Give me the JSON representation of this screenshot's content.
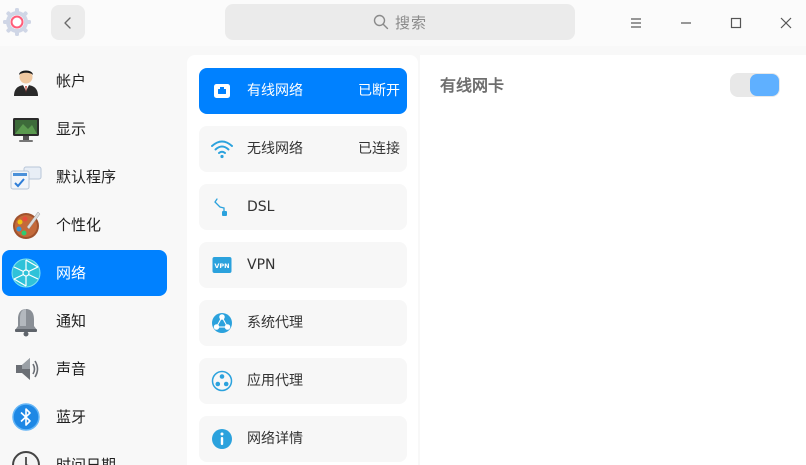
{
  "titlebar": {
    "search_placeholder": "搜索",
    "icons": [
      "gear-icon",
      "back-arrow-icon",
      "search-icon",
      "menu-icon",
      "minimize-icon",
      "maximize-icon",
      "close-icon"
    ]
  },
  "sidebar": {
    "items": [
      {
        "label": "帐户",
        "icon": "account-icon"
      },
      {
        "label": "显示",
        "icon": "display-icon"
      },
      {
        "label": "默认程序",
        "icon": "default-apps-icon"
      },
      {
        "label": "个性化",
        "icon": "personalization-icon"
      },
      {
        "label": "网络",
        "icon": "network-icon",
        "active": true
      },
      {
        "label": "通知",
        "icon": "notification-bell-icon"
      },
      {
        "label": "声音",
        "icon": "speaker-icon"
      },
      {
        "label": "蓝牙",
        "icon": "bluetooth-icon"
      },
      {
        "label": "时间日期",
        "icon": "clock-icon"
      }
    ]
  },
  "network": {
    "items": [
      {
        "label": "有线网络",
        "status": "已断开",
        "icon": "wired-network-icon",
        "active": true
      },
      {
        "label": "无线网络",
        "status": "已连接",
        "icon": "wifi-icon"
      },
      {
        "label": "DSL",
        "status": "",
        "icon": "dsl-icon"
      },
      {
        "label": "VPN",
        "status": "",
        "icon": "vpn-icon"
      },
      {
        "label": "系统代理",
        "status": "",
        "icon": "system-proxy-icon"
      },
      {
        "label": "应用代理",
        "status": "",
        "icon": "app-proxy-icon"
      },
      {
        "label": "网络详情",
        "status": "",
        "icon": "info-icon"
      }
    ]
  },
  "detail": {
    "title": "有线网卡",
    "toggle_on": true
  },
  "colors": {
    "accent": "#0081ff",
    "toggle_knob": "#5fb0ff",
    "icon_blue": "#2ba2dd"
  }
}
